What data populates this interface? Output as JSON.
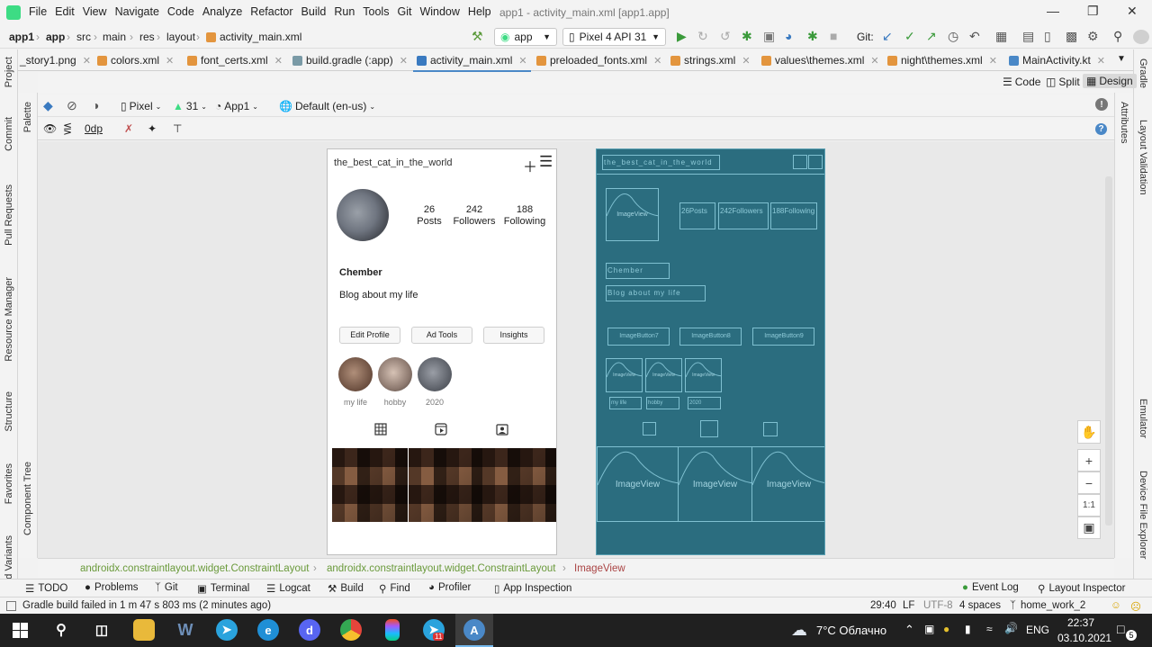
{
  "menubar": {
    "items": [
      "File",
      "Edit",
      "View",
      "Navigate",
      "Code",
      "Analyze",
      "Refactor",
      "Build",
      "Run",
      "Tools",
      "Git",
      "Window",
      "Help"
    ],
    "title": "app1 - activity_main.xml [app1.app]"
  },
  "navbar": {
    "crumbs": [
      "app1",
      "app",
      "src",
      "main",
      "res",
      "layout",
      "activity_main.xml"
    ],
    "run_config": "app",
    "device": "Pixel 4 API 31",
    "git_label": "Git:"
  },
  "tabs": [
    {
      "label": "_story1.png"
    },
    {
      "label": "colors.xml"
    },
    {
      "label": "font_certs.xml"
    },
    {
      "label": "build.gradle (:app)"
    },
    {
      "label": "activity_main.xml"
    },
    {
      "label": "preloaded_fonts.xml"
    },
    {
      "label": "strings.xml"
    },
    {
      "label": "values\\themes.xml"
    },
    {
      "label": "night\\themes.xml"
    },
    {
      "label": "MainActivity.kt"
    }
  ],
  "left_tools": [
    "Project",
    "Commit",
    "Pull Requests",
    "Resource Manager",
    "Structure",
    "Favorites",
    "d Variants"
  ],
  "palette_tools": [
    "Palette",
    "Component Tree"
  ],
  "right_tools": [
    "Gradle",
    "Layout Validation",
    "Emulator",
    "Device File Explorer"
  ],
  "attr_tools": [
    "Attributes"
  ],
  "view_modes": [
    "Code",
    "Split",
    "Design"
  ],
  "design_toolbar": {
    "device": "Pixel",
    "api": "31",
    "theme": "App1",
    "locale": "Default (en-us)",
    "margin": "0dp"
  },
  "profile": {
    "username": "the_best_cat_in_the_world",
    "stats": [
      {
        "value": "26",
        "label": "Posts"
      },
      {
        "value": "242",
        "label": "Followers"
      },
      {
        "value": "188",
        "label": "Following"
      }
    ],
    "name": "Chember",
    "bio": "Blog about my life",
    "buttons": [
      "Edit Profile",
      "Ad Tools",
      "Insights"
    ],
    "highlights": [
      "my life",
      "hobby",
      "2020"
    ]
  },
  "blueprint": {
    "username": "the_best_cat_in_the_world",
    "imageview_label": "ImageView",
    "stats": [
      "26Posts",
      "242Followers",
      "188Following"
    ],
    "name": "Chember",
    "bio": "Blog about my life",
    "buttons": [
      "ImageButton7",
      "ImageButton8",
      "ImageButton9"
    ],
    "highlight_img": "ImageView",
    "highlights": [
      "my life",
      "hobby",
      "2020"
    ]
  },
  "zoom": {
    "fit_label": "1:1"
  },
  "layout_crumbs": [
    "androidx.constraintlayout.widget.ConstraintLayout",
    "androidx.constraintlayout.widget.ConstraintLayout",
    "ImageView"
  ],
  "tool_windows": [
    "TODO",
    "Problems",
    "Git",
    "Terminal",
    "Logcat",
    "Build",
    "Find",
    "Profiler",
    "App Inspection"
  ],
  "tool_windows_right": [
    "Event Log",
    "Layout Inspector"
  ],
  "status": {
    "message": "Gradle build failed in 1 m 47 s 803 ms (2 minutes ago)",
    "position": "29:40",
    "line_sep": "LF",
    "encoding": "UTF-8",
    "indent": "4 spaces",
    "branch": "home_work_2"
  },
  "taskbar": {
    "weather": "7°C  Облачно",
    "lang": "ENG",
    "time": "22:37",
    "date": "03.10.2021",
    "notifications": "5",
    "telegram_badge": "11"
  },
  "colors": {
    "blueprint_bg": "#2b6d7f",
    "blueprint_line": "#7fc0d1",
    "accent": "#4a88c7",
    "android_green": "#3ddc84"
  }
}
